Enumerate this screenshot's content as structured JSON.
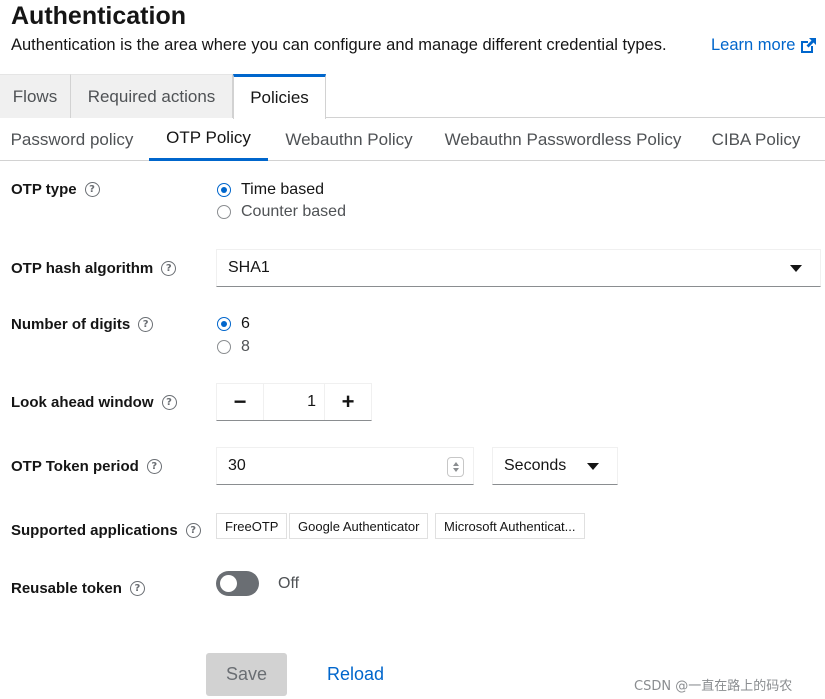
{
  "header": {
    "title": "Authentication",
    "description": "Authentication is the area where you can configure and manage different credential types.",
    "learn_more": "Learn more"
  },
  "main_tabs": [
    {
      "label": "Flows",
      "active": false
    },
    {
      "label": "Required actions",
      "active": false
    },
    {
      "label": "Policies",
      "active": true
    }
  ],
  "sub_tabs": [
    {
      "label": "Password policy",
      "active": false
    },
    {
      "label": "OTP Policy",
      "active": true
    },
    {
      "label": "Webauthn Policy",
      "active": false
    },
    {
      "label": "Webauthn Passwordless Policy",
      "active": false
    },
    {
      "label": "CIBA Policy",
      "active": false
    }
  ],
  "form": {
    "otp_type": {
      "label": "OTP type",
      "options": [
        "Time based",
        "Counter based"
      ],
      "selected": "Time based"
    },
    "hash_algorithm": {
      "label": "OTP hash algorithm",
      "value": "SHA1"
    },
    "digits": {
      "label": "Number of digits",
      "options": [
        "6",
        "8"
      ],
      "selected": "6"
    },
    "look_ahead": {
      "label": "Look ahead window",
      "value": "1",
      "minus": "−",
      "plus": "+"
    },
    "token_period": {
      "label": "OTP Token period",
      "value": "30",
      "unit": "Seconds"
    },
    "supported_apps": {
      "label": "Supported applications",
      "apps": [
        "FreeOTP",
        "Google Authenticator",
        "Microsoft Authenticat..."
      ]
    },
    "reusable_token": {
      "label": "Reusable token",
      "state": "Off"
    }
  },
  "actions": {
    "save": "Save",
    "reload": "Reload"
  },
  "watermark": "CSDN @一直在路上的码农",
  "colors": {
    "accent": "#0066cc",
    "toggle_off": "#6a6e73",
    "disabled_button": "#d2d2d2"
  }
}
